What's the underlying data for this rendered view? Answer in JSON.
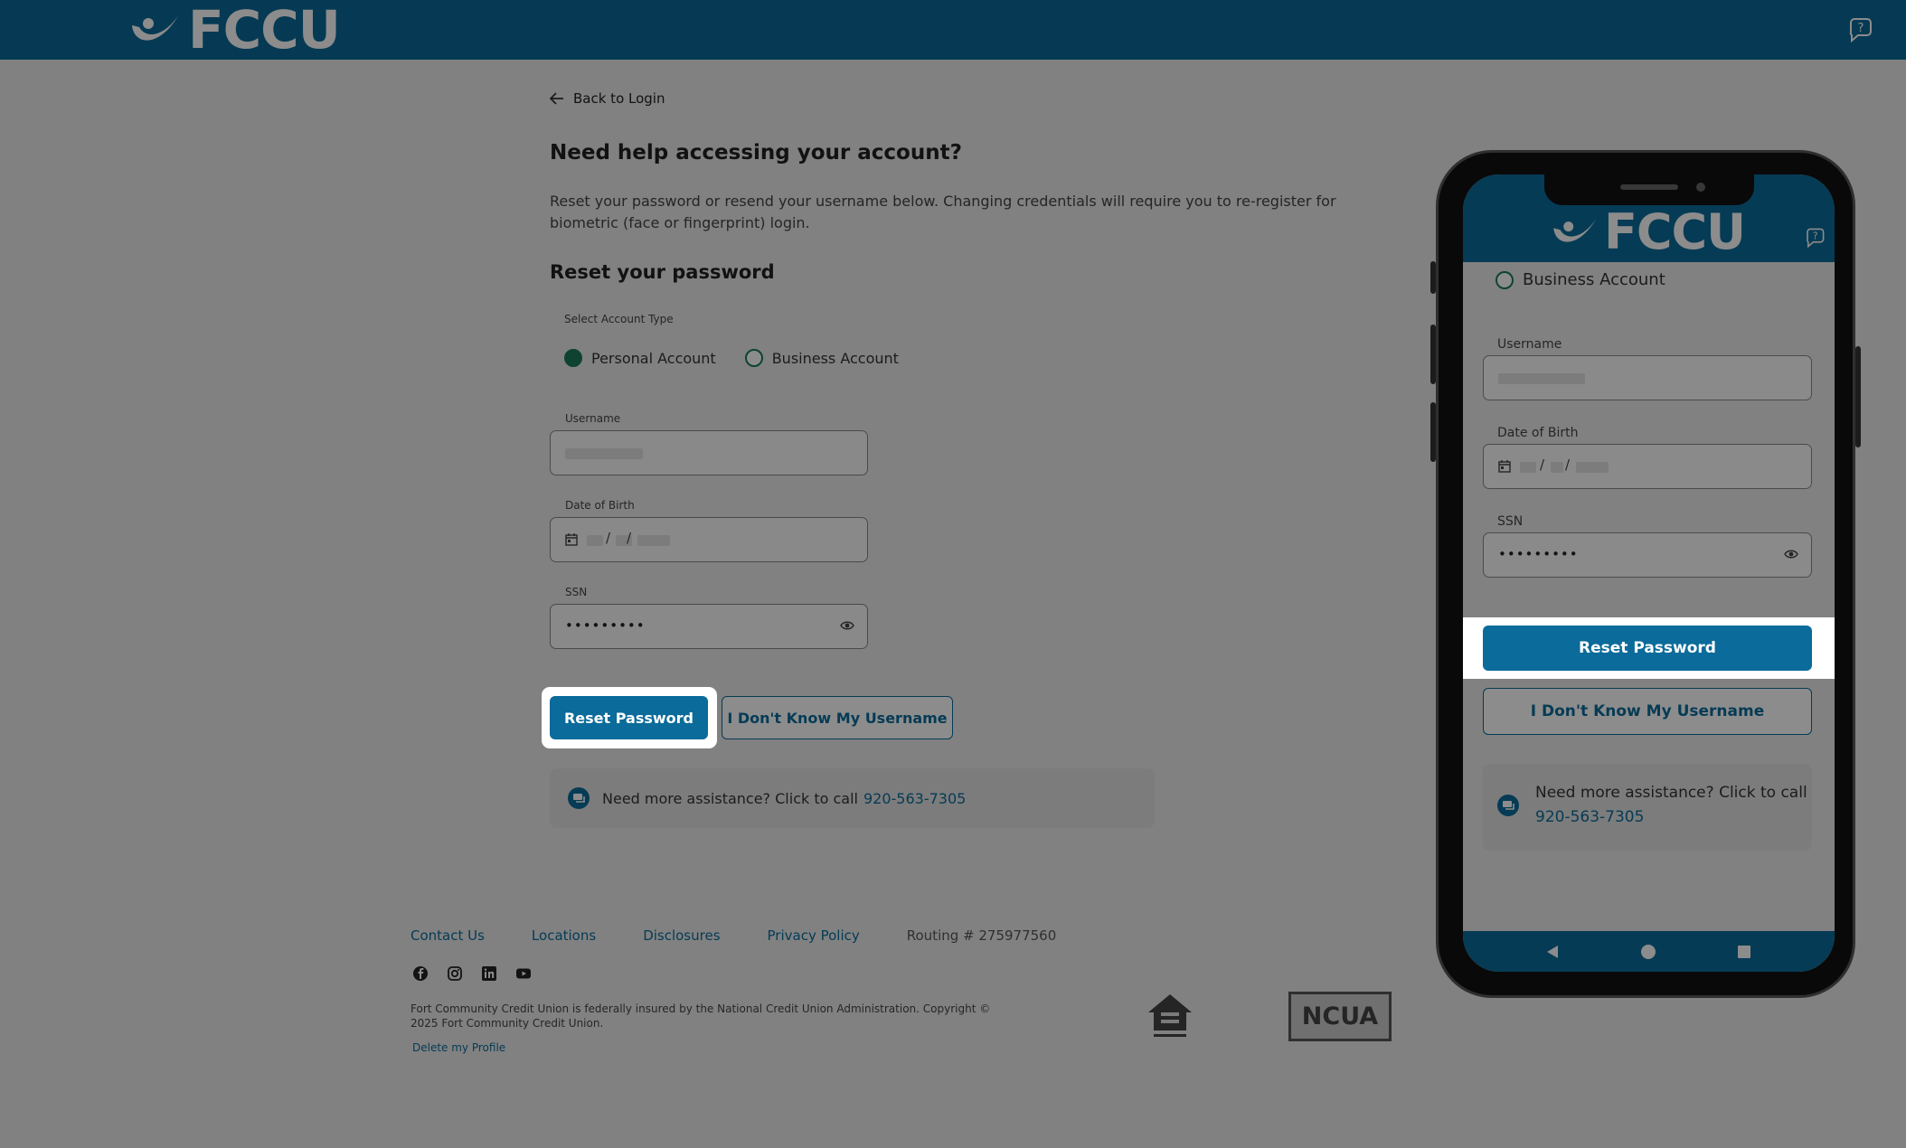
{
  "header": {
    "brand": "FCCU"
  },
  "back_link": "Back to Login",
  "title": "Need help accessing your account?",
  "description": "Reset your password or resend your username below. Changing credentials will require you to re-register for biometric (face or fingerprint) login.",
  "section_title": "Reset your password",
  "account_type": {
    "label": "Select Account Type",
    "options": [
      "Personal Account",
      "Business Account"
    ],
    "selected": "Personal Account"
  },
  "fields": {
    "username_label": "Username",
    "dob_label": "Date of Birth",
    "dob_sep1": "/",
    "dob_sep2": "/",
    "ssn_label": "SSN",
    "ssn_value": "•••••••••"
  },
  "buttons": {
    "reset": "Reset Password",
    "forgot_username": "I Don't Know My Username"
  },
  "assist": {
    "text": "Need more assistance? Click to call",
    "phone": "920-563-7305"
  },
  "footer": {
    "links": [
      "Contact Us",
      "Locations",
      "Disclosures",
      "Privacy Policy"
    ],
    "routing": "Routing # 275977560",
    "social": [
      "facebook-icon",
      "instagram-icon",
      "linkedin-icon",
      "youtube-icon"
    ],
    "fine_print": "Fort Community Credit Union is federally insured by the National Credit Union Administration. Copyright © 2025 Fort Community Credit Union.",
    "delete_profile": "Delete my Profile",
    "ncua": "NCUA"
  },
  "phone_preview": {
    "brand": "FCCU",
    "business_option": "Business Account",
    "username_label": "Username",
    "dob_label": "Date of Birth",
    "dob_sep1": "/",
    "dob_sep2": "/",
    "ssn_label": "SSN",
    "ssn_value": "•••••••••",
    "reset": "Reset Password",
    "forgot_username": "I Don't Know My Username",
    "assist_text": "Need more assistance? Click to call",
    "phone": "920-563-7305"
  },
  "colors": {
    "brand": "#0b6b9a",
    "radio": "#1a7a5a",
    "background": "#ebebeb"
  }
}
